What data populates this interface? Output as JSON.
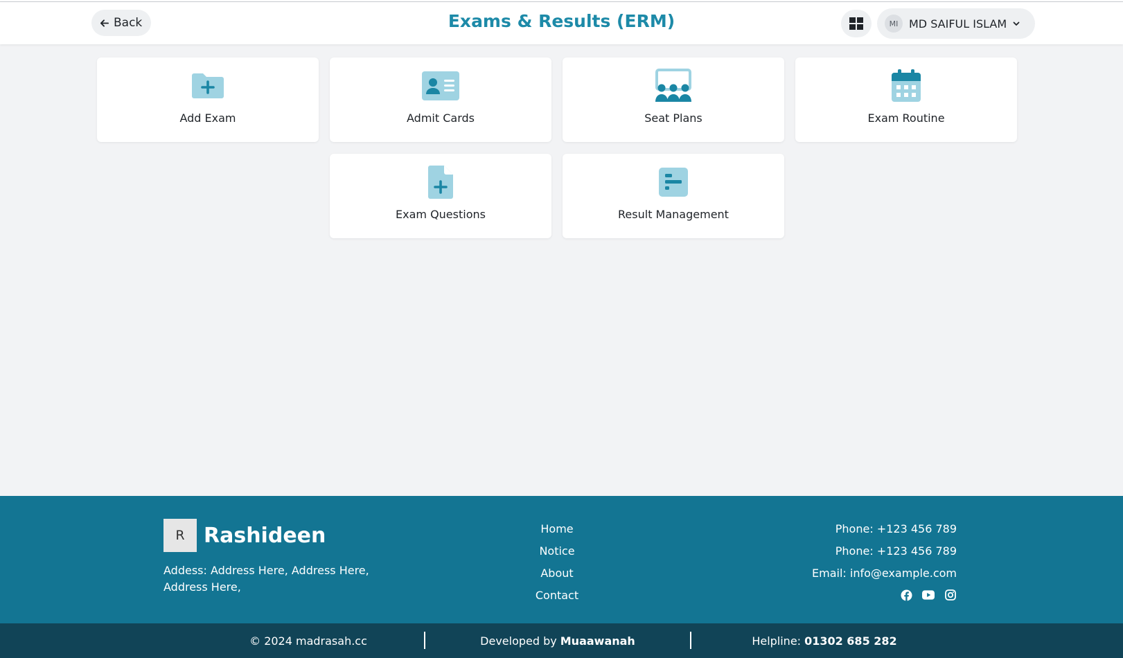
{
  "header": {
    "back_label": "Back",
    "title": "Exams & Results (ERM)",
    "user": {
      "initials": "MI",
      "name": "MD SAIFUL ISLAM"
    }
  },
  "cards": [
    {
      "label": "Add Exam",
      "icon": "folder-plus-icon"
    },
    {
      "label": "Admit Cards",
      "icon": "id-card-icon"
    },
    {
      "label": "Seat Plans",
      "icon": "seat-plan-icon"
    },
    {
      "label": "Exam Routine",
      "icon": "calendar-icon"
    },
    {
      "label": "Exam Questions",
      "icon": "file-plus-icon"
    },
    {
      "label": "Result Management",
      "icon": "result-chart-icon"
    }
  ],
  "footer": {
    "logo_letter": "R",
    "brand_name": "Rashideen",
    "address": "Addess: Address Here, Address Here, Address Here,",
    "links": [
      "Home",
      "Notice",
      "About",
      "Contact"
    ],
    "phone1": "Phone: +123 456 789",
    "phone2": "Phone: +123 456 789",
    "email": "Email: info@example.com",
    "socials": [
      "facebook-icon",
      "youtube-icon",
      "instagram-icon"
    ]
  },
  "bottom_bar": {
    "copyright": "© 2024 madrasah.cc",
    "developed_prefix": "Developed by",
    "developer": "Muaawanah",
    "helpline_prefix": "Helpline:",
    "helpline": "01302 685 282"
  },
  "colors": {
    "accent": "#1d8aa8",
    "icon_light": "#9fd3e2",
    "icon_dark": "#1a86a4",
    "footer_bg": "#137593",
    "bottom_bar_bg": "#114457",
    "page_bg": "#f2f3f5"
  }
}
